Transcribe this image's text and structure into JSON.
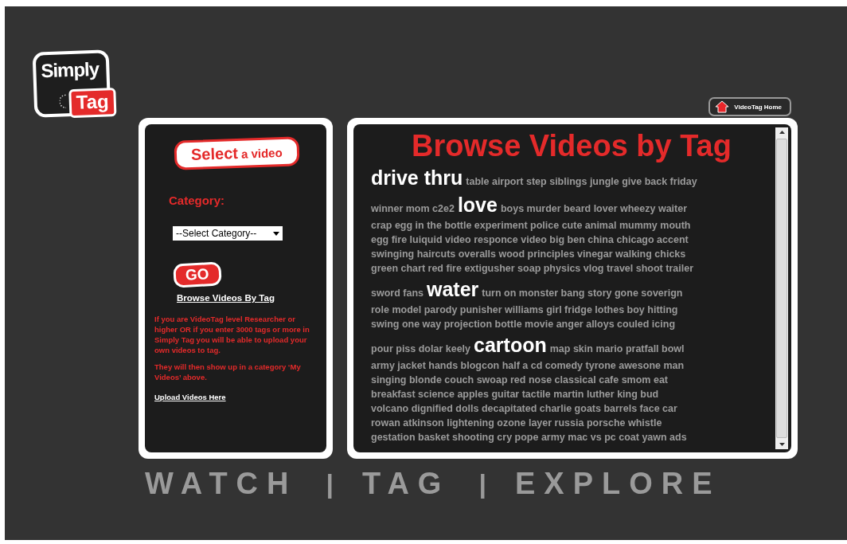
{
  "logo": {
    "word_1": "Simply",
    "word_2": "Tag"
  },
  "home_button": {
    "label": "VideoTag Home"
  },
  "select_panel": {
    "heading_1": "Select",
    "heading_2": "a video",
    "category_label": "Category:",
    "category_select": {
      "value": "--Select Category--"
    },
    "go_button": "GO",
    "browse_link": "Browse Videos By Tag",
    "notes": [
      "If you are VideoTag level Researcher or higher OR if you enter 3000 tags or more in Simply Tag you will be able to upload your own videos to tag.",
      "They will then show up in a category ‘My Videos’ above."
    ],
    "upload_link": "Upload Videos Here"
  },
  "tag_panel": {
    "title": "Browse Videos by Tag",
    "lines": [
      [
        {
          "kind": "big",
          "text": "drive thru"
        },
        {
          "kind": "small",
          "text": "table airport step siblings jungle give back friday"
        }
      ],
      [
        {
          "kind": "small",
          "text": "winner mom c2e2"
        },
        {
          "kind": "big",
          "text": "love"
        },
        {
          "kind": "small",
          "text": "boys murder beard lover wheezy waiter"
        }
      ],
      [
        {
          "kind": "small",
          "text": "crap egg in the bottle experiment police cute animal mummy mouth"
        }
      ],
      [
        {
          "kind": "small",
          "text": "egg fire luiquid video responce video big ben china chicago accent"
        }
      ],
      [
        {
          "kind": "small",
          "text": "swinging haircuts overalls wood principles vinegar walking chicks"
        }
      ],
      [
        {
          "kind": "small",
          "text": "green chart red fire extigusher soap physics vlog travel shoot trailer"
        }
      ],
      [
        {
          "kind": "small",
          "text": "sword fans"
        },
        {
          "kind": "big",
          "text": "water"
        },
        {
          "kind": "small",
          "text": "turn on monster bang story gone soverign"
        }
      ],
      [
        {
          "kind": "small",
          "text": "role model parody punisher williams girl fridge lothes boy hitting"
        }
      ],
      [
        {
          "kind": "small",
          "text": "swing one way projection bottle movie anger alloys couled icing"
        }
      ],
      [
        {
          "kind": "small",
          "text": "pour piss dolar keely"
        },
        {
          "kind": "big",
          "text": "cartoon"
        },
        {
          "kind": "small",
          "text": "map skin mario pratfall bowl"
        }
      ],
      [
        {
          "kind": "small",
          "text": "army jacket hands blogcon half a cd comedy tyrone awesone man"
        }
      ],
      [
        {
          "kind": "small",
          "text": "singing blonde couch swoap red nose classical cafe smom eat"
        }
      ],
      [
        {
          "kind": "small",
          "text": "breakfast science apples guitar tactile martin luther king bud"
        }
      ],
      [
        {
          "kind": "small",
          "text": "volcano dignified dolls decapitated charlie goats barrels face car"
        }
      ],
      [
        {
          "kind": "small",
          "text": "rowan atkinson lightening ozone layer russia porsche whistle"
        }
      ],
      [
        {
          "kind": "small",
          "text": "gestation basket shooting cry pope army mac vs pc coat yawn ads"
        }
      ]
    ]
  },
  "footer_nav": [
    {
      "kind": "link",
      "text": "WATCH"
    },
    {
      "kind": "separator",
      "text": "|"
    },
    {
      "kind": "link",
      "text": "TAG"
    },
    {
      "kind": "separator",
      "text": "|"
    },
    {
      "kind": "link",
      "text": "EXPLORE"
    }
  ]
}
